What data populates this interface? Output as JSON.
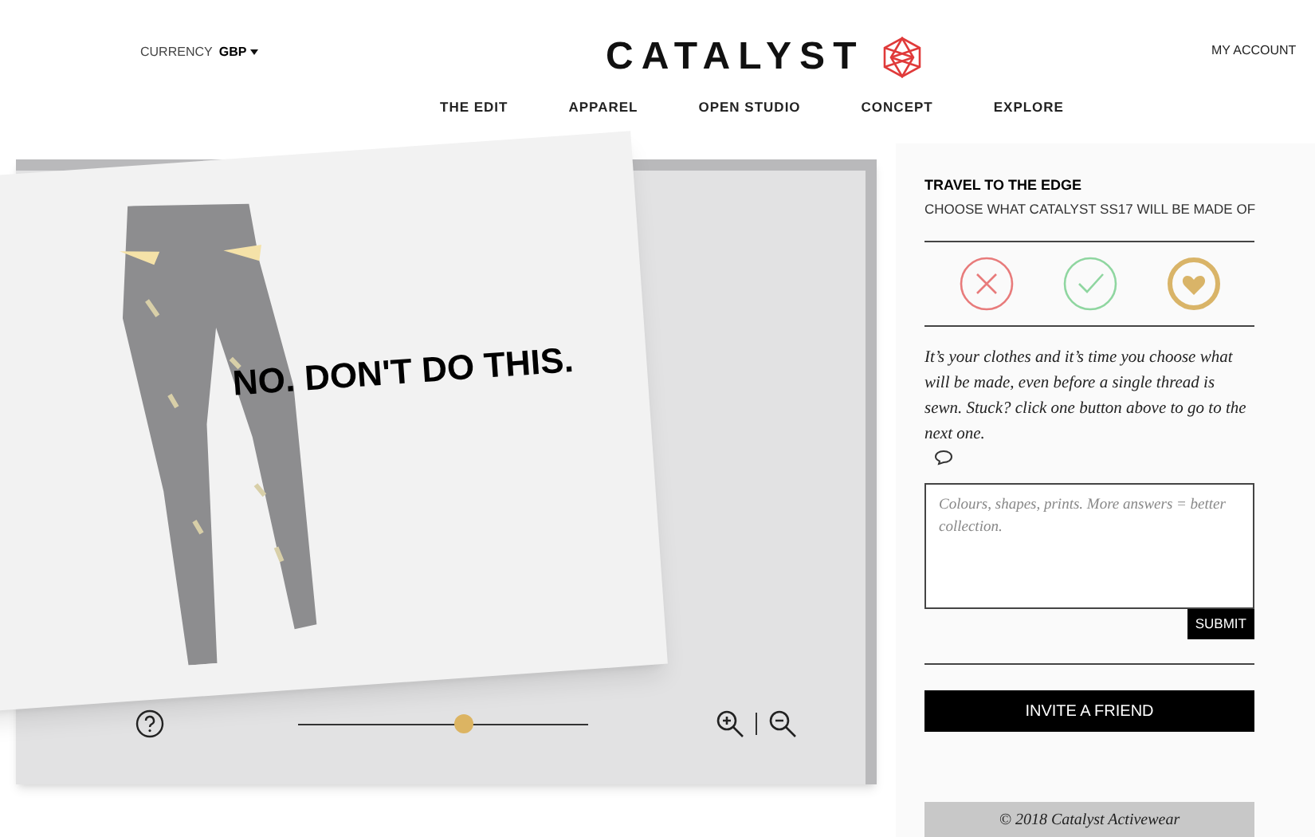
{
  "header": {
    "currency_label": "CURRENCY",
    "currency_value": "GBP",
    "logo": "CATALYST",
    "account": "MY ACCOUNT"
  },
  "nav": [
    "THE EDIT",
    "APPAREL",
    "OPEN STUDIO",
    "CONCEPT",
    "EXPLORE"
  ],
  "viewer": {
    "card_caption": "NO. DON'T DO THIS.",
    "zoom": {
      "level": 0.57
    }
  },
  "panel": {
    "title": "TRAVEL TO THE EDGE",
    "subtitle": "CHOOSE WHAT CATALYST SS17 WILL BE MADE OF",
    "choices": [
      {
        "kind": "reject",
        "color": "#e87b7b"
      },
      {
        "kind": "accept",
        "color": "#8fd6a0"
      },
      {
        "kind": "love",
        "color": "#d9b468"
      }
    ],
    "intro": "It’s your clothes and it’s time you choose what will be made, even before a single thread is sewn. Stuck? click one button above to go to the next one.",
    "answer_placeholder": "Colours, shapes, prints. More answers = better collection.",
    "submit": "SUBMIT",
    "invite": "INVITE A FRIEND",
    "footer": "© 2018 Catalyst Activewear"
  }
}
